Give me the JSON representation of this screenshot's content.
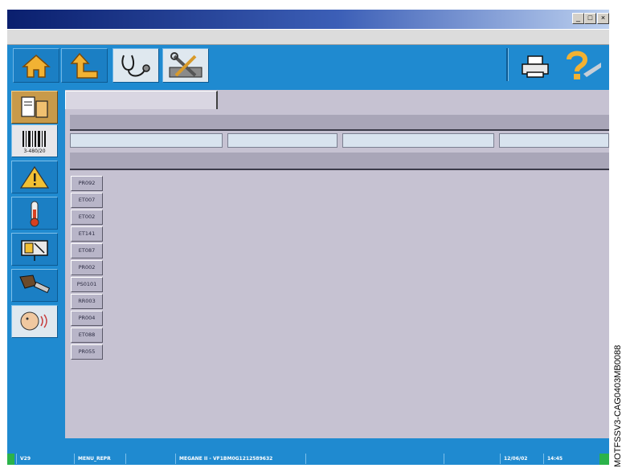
{
  "window": {
    "controls": [
      "_",
      "□",
      "×"
    ]
  },
  "toolbar": {
    "buttons": [
      {
        "name": "home-icon"
      },
      {
        "name": "back-up-icon"
      },
      {
        "name": "stethoscope-icon"
      },
      {
        "name": "tools-icon"
      }
    ],
    "right": [
      {
        "name": "printer-icon"
      },
      {
        "name": "help-icon"
      }
    ]
  },
  "sidebar": {
    "items": [
      {
        "name": "documents-icon",
        "active": true
      },
      {
        "name": "barcode-icon",
        "label": "3-480/20"
      },
      {
        "name": "warning-icon"
      },
      {
        "name": "thermometer-icon"
      },
      {
        "name": "actuator-icon"
      },
      {
        "name": "pedal-icon"
      },
      {
        "name": "operator-voice-icon"
      }
    ]
  },
  "list": [
    "PR092",
    "ET007",
    "ET002",
    "ET141",
    "ET087",
    "PR002",
    "PS0101",
    "RR003",
    "PR004",
    "ET088",
    "PR055"
  ],
  "status": {
    "version": "V29",
    "menu": "MENU_REPR",
    "vehicle": "MEGANE II - VF1BM0G1212589632",
    "date": "12/06/02",
    "time": "14:45"
  },
  "watermark_text": "MOTFSSV3-CAG0403MB0088",
  "colors": {
    "frame_blue": "#1f8ad0",
    "panel": "#c6c2d2",
    "status_green": "#2bb34a"
  }
}
